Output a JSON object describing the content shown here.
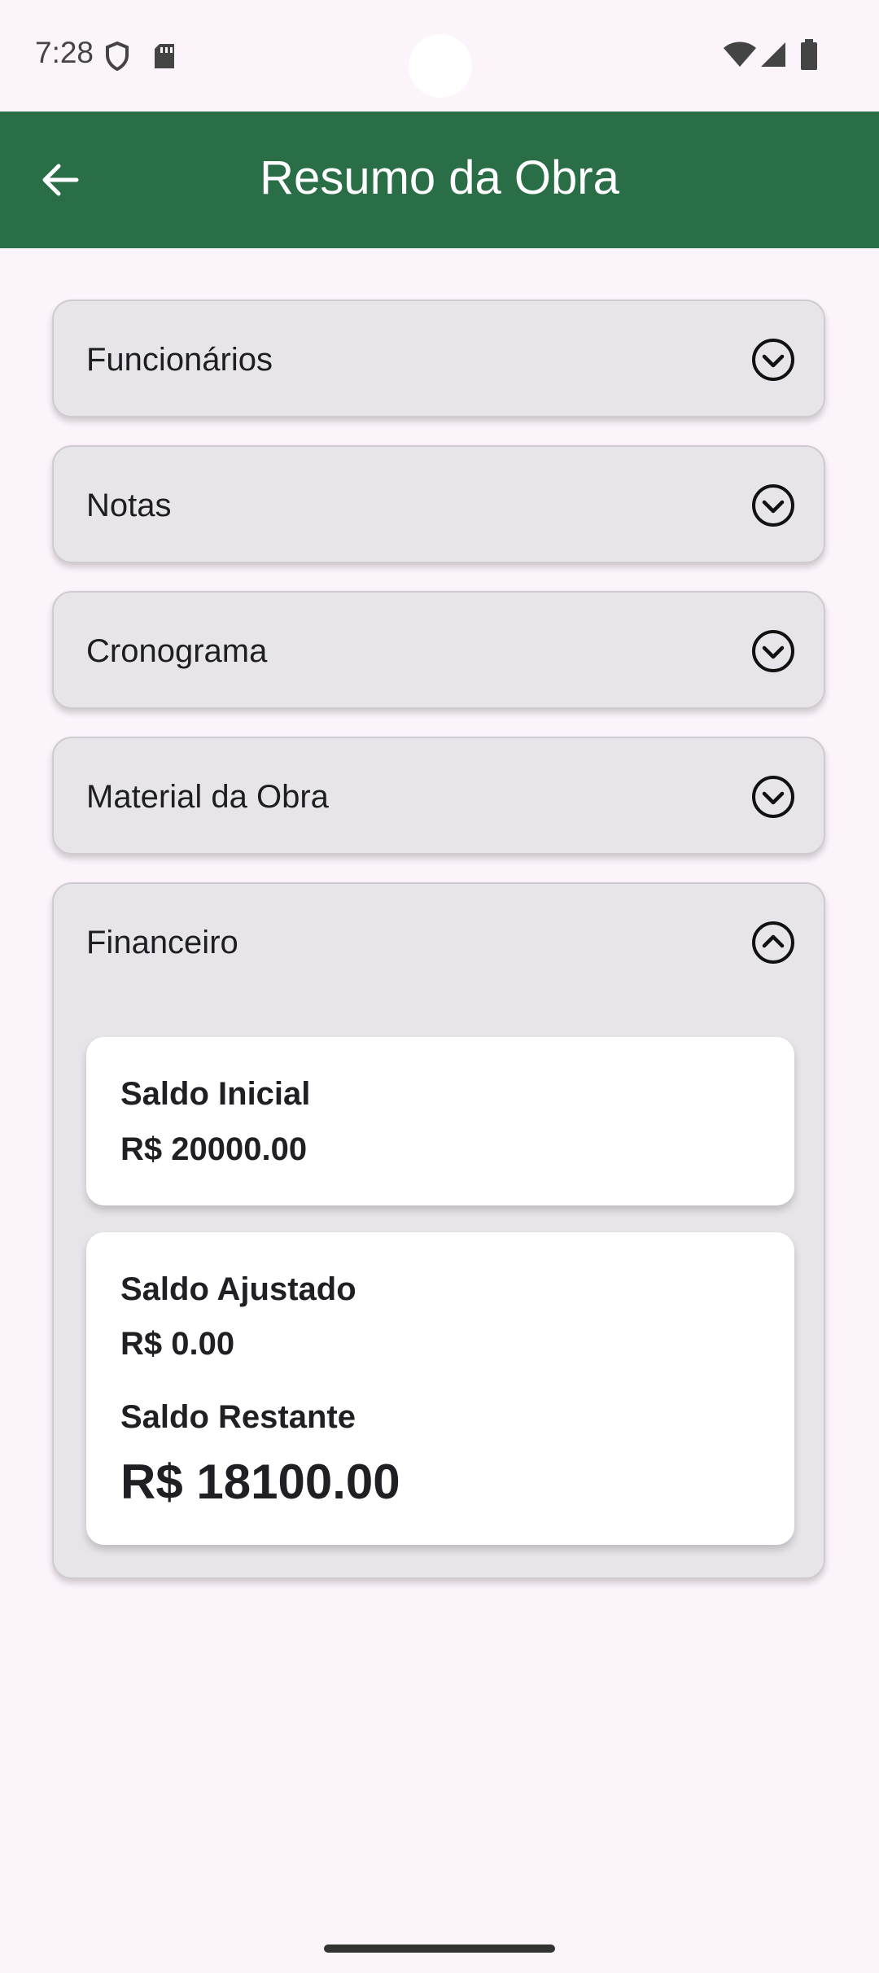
{
  "status_bar": {
    "time": "7:28",
    "icons": [
      "shield-icon",
      "sd-card-icon",
      "wifi-icon",
      "signal-icon",
      "battery-icon"
    ]
  },
  "app_bar": {
    "title": "Resumo da Obra",
    "back_icon": "arrow-back-icon",
    "color": "#2a6e47"
  },
  "sections": [
    {
      "label": "Funcionários",
      "expanded": false
    },
    {
      "label": "Notas",
      "expanded": false
    },
    {
      "label": "Cronograma",
      "expanded": false
    },
    {
      "label": "Material da Obra",
      "expanded": false
    },
    {
      "label": "Financeiro",
      "expanded": true
    }
  ],
  "financeiro": {
    "saldo_inicial_label": "Saldo Inicial",
    "saldo_inicial_value": "R$ 20000.00",
    "saldo_ajustado_label": "Saldo Ajustado",
    "saldo_ajustado_value": "R$ 0.00",
    "saldo_restante_label": "Saldo Restante",
    "saldo_restante_value": "R$ 18100.00"
  }
}
